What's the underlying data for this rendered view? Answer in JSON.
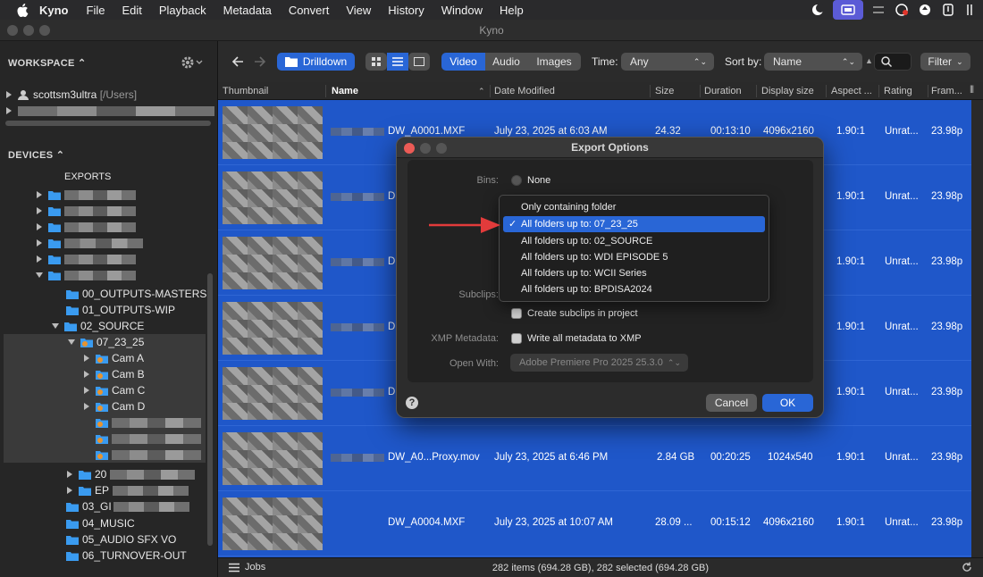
{
  "menubar": {
    "app": "Kyno",
    "items": [
      "File",
      "Edit",
      "Playback",
      "Metadata",
      "Convert",
      "View",
      "History",
      "Window",
      "Help"
    ]
  },
  "window": {
    "title": "Kyno"
  },
  "sidebar": {
    "workspace_label": "WORKSPACE",
    "workspace_items": [
      {
        "name": "scottsm3ultra",
        "detail": "[/Users]"
      }
    ],
    "devices_label": "DEVICES",
    "partial_top": "EXPORTS",
    "folders": [
      "00_OUTPUTS-MASTERS",
      "01_OUTPUTS-WIP",
      "02_SOURCE",
      "07_23_25",
      "Cam A",
      "Cam B",
      "Cam C",
      "Cam D"
    ],
    "folders_lower": [
      "20",
      "EP",
      "03_GI",
      "04_MUSIC",
      "05_AUDIO SFX VO",
      "06_TURNOVER-OUT"
    ]
  },
  "toolbar": {
    "drilldown": "Drilldown",
    "filters": [
      "Video",
      "Audio",
      "Images"
    ],
    "time_label": "Time:",
    "time_value": "Any",
    "sortby_label": "Sort by:",
    "sortby_value": "Name",
    "filter_button": "Filter"
  },
  "table": {
    "columns": [
      "Thumbnail",
      "Name",
      "Date Modified",
      "Size",
      "Duration",
      "Display size",
      "Aspect ...",
      "Rating",
      "Fram..."
    ],
    "rows": [
      {
        "name": "DW_A0001.MXF",
        "date": "July 23, 2025 at 6:03 AM",
        "size": "24.32",
        "duration": "00:13:10",
        "display": "4096x2160",
        "aspect": "1.90:1",
        "rating": "Unrat...",
        "frame": "23.98p"
      },
      {
        "name": "D",
        "date": "",
        "size": "",
        "duration": "",
        "display": "",
        "aspect": "1.90:1",
        "rating": "Unrat...",
        "frame": "23.98p"
      },
      {
        "name": "D",
        "date": "",
        "size": "",
        "duration": "",
        "display": "",
        "aspect": "1.90:1",
        "rating": "Unrat...",
        "frame": "23.98p"
      },
      {
        "name": "D",
        "date": "",
        "size": "",
        "duration": "",
        "display": "",
        "aspect": "1.90:1",
        "rating": "Unrat...",
        "frame": "23.98p"
      },
      {
        "name": "D",
        "date": "",
        "size": "",
        "duration": "",
        "display": "",
        "aspect": "1.90:1",
        "rating": "Unrat...",
        "frame": "23.98p"
      },
      {
        "name": "DW_A0...Proxy.mov",
        "date": "July 23, 2025 at 6:46 PM",
        "size": "2.84 GB",
        "duration": "00:20:25",
        "display": "1024x540",
        "aspect": "1.90:1",
        "rating": "Unrat...",
        "frame": "23.98p"
      },
      {
        "name": "DW_A0004.MXF",
        "date": "July 23, 2025 at 10:07 AM",
        "size": "28.09 ...",
        "duration": "00:15:12",
        "display": "4096x2160",
        "aspect": "1.90:1",
        "rating": "Unrat...",
        "frame": "23.98p"
      }
    ]
  },
  "statusbar": {
    "jobs": "Jobs",
    "count": "282 items (694.28 GB), 282 selected (694.28 GB)"
  },
  "dialog": {
    "title": "Export Options",
    "bins_label": "Bins:",
    "bins_value": "None",
    "subclips_label": "Subclips:",
    "subclips_option": "Create subclips in project",
    "xmp_label": "XMP Metadata:",
    "xmp_option": "Write all metadata to XMP",
    "openwith_label": "Open With:",
    "openwith_value": "Adobe Premiere Pro 2025 25.3.0",
    "cancel": "Cancel",
    "ok": "OK",
    "help": "?",
    "dropdown": {
      "items": [
        "Only containing folder",
        "All folders up to: 07_23_25",
        "All folders up to: 02_SOURCE",
        "All folders up to: WDI EPISODE 5",
        "All folders up to: WCII Series",
        "All folders up to: BPDISA2024"
      ],
      "checkmark": "✓"
    }
  },
  "colors": {
    "selection_blue": "#1f57c9",
    "accent": "#2966d6",
    "annotation_arrow": "#e23b3b"
  }
}
